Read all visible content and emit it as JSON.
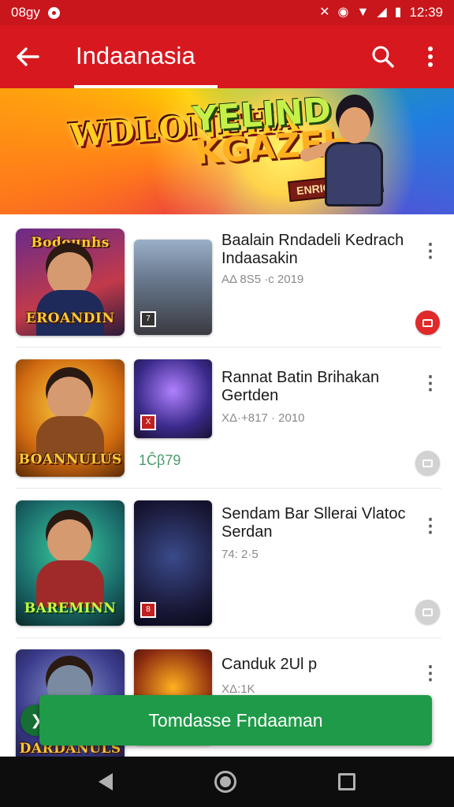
{
  "status_bar": {
    "left_text": "08gy",
    "time": "12:39",
    "icons": [
      "bluetooth-icon",
      "eye-icon",
      "wifi-icon",
      "signal-icon",
      "battery-icon"
    ]
  },
  "app_bar": {
    "title": "Indaanasia",
    "back_icon": "arrow-left-icon",
    "search_icon": "search-icon",
    "more_icon": "more-vertical-icon"
  },
  "banner": {
    "title_line_1": "WDLONEHA",
    "title_line_2": "YELIND",
    "title_line_3": "KGAZEH",
    "badge": "ENRIGIS DIANI"
  },
  "items": [
    {
      "cover_label": "Bodounhs",
      "cover_label_2": "EROANDIN",
      "title": "Baalain Rndadeli Kedrach Indaasakin",
      "meta": "AΔ 8S5 ·c 2019",
      "aside": "",
      "chip": "red"
    },
    {
      "cover_label": "",
      "cover_label_2": "BOANNULUS",
      "title": "Rannat Batin Brihakan Gertden",
      "meta": "XΔ·+817 · 2010",
      "aside": "1Ĉβ79",
      "chip": "grey"
    },
    {
      "cover_label": "",
      "cover_label_2": "BAREMINN",
      "title": "Sendam Bar Sllerai Vlatoc Serdan",
      "meta": "74: 2·5",
      "aside": "",
      "chip": "grey"
    },
    {
      "cover_label": "",
      "cover_label_2": "DARDANULS",
      "title": "Canduk 2Ul p",
      "meta": "XΔ:1K",
      "aside": "",
      "chip": "grey"
    }
  ],
  "action_button": {
    "label": "Tomdasse Fndaaman"
  },
  "colors": {
    "app_bar": "#d7191f",
    "status_bar": "#c8161c",
    "action_button": "#1f9a48",
    "nav_bar": "#0d0d0d"
  }
}
